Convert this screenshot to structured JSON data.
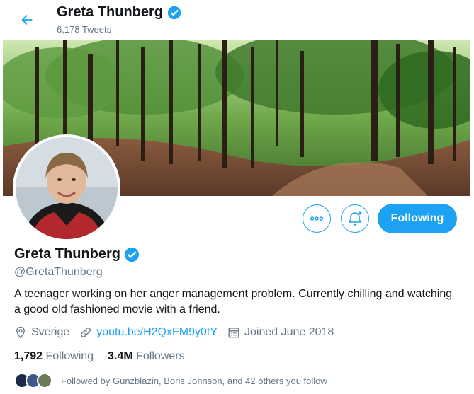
{
  "header": {
    "title": "Greta Thunberg",
    "tweet_count": "6,178 Tweets"
  },
  "profile": {
    "name": "Greta Thunberg",
    "handle": "@GretaThunberg",
    "bio": "A teenager working on her anger management problem. Currently chilling and watching a good old fashioned movie with a friend.",
    "location": "Sverige",
    "link": "youtu.be/H2QxFM9y0tY",
    "joined": "Joined June 2018",
    "following_count": "1,792",
    "following_label": "Following",
    "followers_count": "3.4M",
    "followers_label": "Followers",
    "followed_by": "Followed by Gunzblazin, Boris Johnson, and 42 others you follow"
  },
  "actions": {
    "follow_label": "Following"
  },
  "colors": {
    "accent": "#1da1f2",
    "secondary_text": "#657786"
  },
  "icons": [
    "back-arrow-icon",
    "verified-badge-icon",
    "more-icon",
    "notification-bell-icon",
    "location-icon",
    "link-icon",
    "calendar-icon"
  ]
}
